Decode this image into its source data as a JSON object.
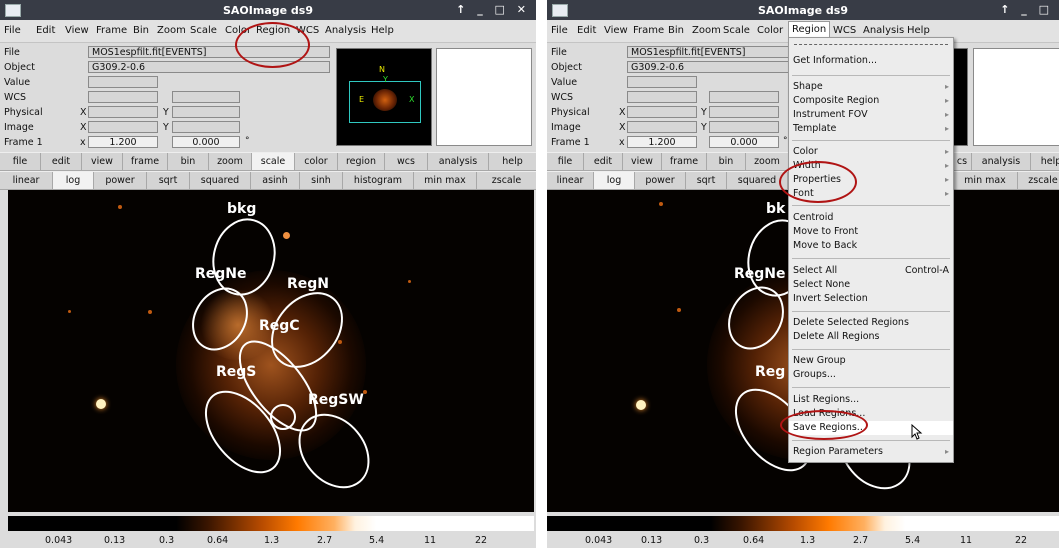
{
  "left": {
    "title": "SAOImage ds9",
    "window_controls": "↑ _ □ ✕",
    "menus": [
      "File",
      "Edit",
      "View",
      "Frame",
      "Bin",
      "Zoom",
      "Scale",
      "Color",
      "Region",
      "WCS",
      "Analysis",
      "Help"
    ],
    "info": {
      "file_label": "File",
      "file_value": "MOS1espfilt.fit[EVENTS]",
      "object_label": "Object",
      "object_value": "G309.2-0.6",
      "value_label": "Value",
      "wcs_label": "WCS",
      "physical_label": "Physical",
      "image_label": "Image",
      "frame_label": "Frame 1",
      "x": "X",
      "y": "Y",
      "x_lower": "x",
      "zoom_value": "1.200",
      "angle_value": "0.000",
      "degree": "°"
    },
    "buttons1": [
      "file",
      "edit",
      "view",
      "frame",
      "bin",
      "zoom",
      "scale",
      "color",
      "region",
      "wcs",
      "analysis",
      "help"
    ],
    "buttons2": [
      "linear",
      "log",
      "power",
      "sqrt",
      "squared",
      "asinh",
      "sinh",
      "histogram",
      "min max",
      "zscale"
    ],
    "regions": [
      "bkg",
      "RegNe",
      "RegN",
      "RegC",
      "RegS",
      "RegSW"
    ],
    "colorbar_ticks": [
      "0.043",
      "0.13",
      "0.3",
      "0.64",
      "1.3",
      "2.7",
      "5.4",
      "11",
      "22"
    ]
  },
  "right": {
    "title": "SAOImage ds9",
    "window_controls": "↑ _ □",
    "menus": [
      "File",
      "Edit",
      "View",
      "Frame",
      "Bin",
      "Zoom",
      "Scale",
      "Color",
      "Region",
      "WCS",
      "Analysis",
      "Help"
    ],
    "info": {
      "file_label": "File",
      "file_value": "MOS1espfilt.fit[EVENTS]",
      "object_label": "Object",
      "object_value": "G309.2-0.6",
      "value_label": "Value",
      "wcs_label": "WCS",
      "physical_label": "Physical",
      "image_label": "Image",
      "frame_label": "Frame 1",
      "x": "X",
      "y": "Y",
      "x_lower": "x",
      "zoom_value": "1.200",
      "angle_value": "0.000",
      "degree": "°"
    },
    "buttons1": [
      "file",
      "edit",
      "view",
      "frame",
      "bin",
      "zoom",
      "cs",
      "analysis",
      "help"
    ],
    "buttons2": [
      "linear",
      "log",
      "power",
      "sqrt",
      "squared",
      "min max",
      "zscale"
    ],
    "regions": [
      "bk",
      "RegNe",
      "Reg"
    ],
    "colorbar_ticks": [
      "0.043",
      "0.13",
      "0.3",
      "0.64",
      "1.3",
      "2.7",
      "5.4",
      "11",
      "22"
    ],
    "region_menu": {
      "get_information": "Get Information...",
      "shape": "Shape",
      "composite_region": "Composite Region",
      "instrument_fov": "Instrument FOV",
      "template": "Template",
      "color": "Color",
      "width": "Width",
      "properties": "Properties",
      "font": "Font",
      "centroid": "Centroid",
      "move_to_front": "Move to Front",
      "move_to_back": "Move to Back",
      "select_all": "Select All",
      "select_all_shortcut": "Control-A",
      "select_none": "Select None",
      "invert_selection": "Invert Selection",
      "delete_selected": "Delete Selected Regions",
      "delete_all": "Delete All Regions",
      "new_group": "New Group",
      "groups": "Groups...",
      "list_regions": "List Regions...",
      "load_regions": "Load Regions...",
      "save_regions": "Save Regions...",
      "region_parameters": "Region Parameters"
    }
  },
  "colors": {
    "highlight_ring": "#b01414",
    "title_bar": "#383c46",
    "region_outline": "#ffffff"
  }
}
